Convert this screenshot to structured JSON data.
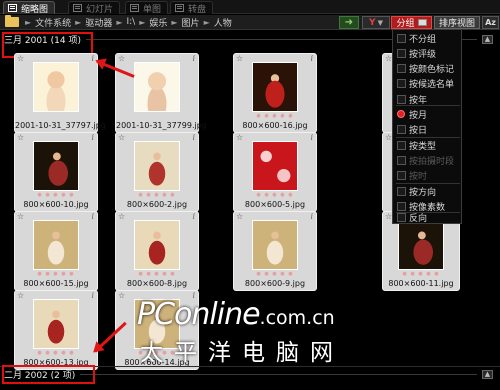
{
  "tabs": [
    {
      "label": "缩略图",
      "active": true
    },
    {
      "label": "幻灯片",
      "active": false
    },
    {
      "label": "单图",
      "active": false
    },
    {
      "label": "转盘",
      "active": false
    }
  ],
  "breadcrumbs": [
    "文件系统",
    "驱动器",
    "I:\\",
    "娱乐",
    "图片",
    "人物"
  ],
  "breadcrumb_separator": "►",
  "toolbar": {
    "filter_label": "Y",
    "group_label": "分组",
    "sort_label": "排序视图",
    "az_label": "Az"
  },
  "groups": [
    {
      "label": "三月 2001 (14 项)",
      "toggle": "▲"
    },
    {
      "label": "二月 2002 (2 项)",
      "toggle": "▲"
    }
  ],
  "thumbnails": [
    {
      "name": "2001-10-31_37797.jpg",
      "style": "baby1",
      "dots": ""
    },
    {
      "name": "2001-10-31_37799.jpg",
      "style": "baby2",
      "dots": ""
    },
    {
      "name": "800×600-16.jpg",
      "style": "red",
      "dots": "● ● ● ● ●"
    },
    {
      "name": "",
      "style": "",
      "dots": ""
    },
    {
      "name": "800×600-10.jpg",
      "style": "dark",
      "dots": "● ● ● ● ●"
    },
    {
      "name": "800×600-2.jpg",
      "style": "cream",
      "dots": "● ● ● ● ●"
    },
    {
      "name": "800×600-5.jpg",
      "style": "flowers",
      "dots": "● ● ● ● ●"
    },
    {
      "name": "",
      "style": "",
      "dots": ""
    },
    {
      "name": "800×600-15.jpg",
      "style": "gold",
      "dots": "● ● ● ● ●"
    },
    {
      "name": "800×600-8.jpg",
      "style": "pale",
      "dots": "● ● ● ● ●"
    },
    {
      "name": "800×600-9.jpg",
      "style": "gold",
      "dots": "● ● ● ● ●"
    },
    {
      "name": "800×600-11.jpg",
      "style": "dark",
      "dots": "● ● ● ● ●"
    },
    {
      "name": "800×600-13.jpg",
      "style": "pale",
      "dots": "● ● ● ● ●"
    },
    {
      "name": "800×600-14.jpg",
      "style": "gold",
      "dots": "● ● ● ● ●"
    }
  ],
  "group_menu": [
    {
      "label": "不分组",
      "kind": "check",
      "state": "normal"
    },
    {
      "label": "按评级",
      "kind": "check",
      "state": "normal"
    },
    {
      "label": "按颜色标记",
      "kind": "check",
      "state": "normal"
    },
    {
      "label": "按候选名单",
      "kind": "check",
      "state": "normal"
    },
    {
      "label": "按年",
      "kind": "check",
      "state": "normal"
    },
    {
      "label": "按月",
      "kind": "radio",
      "state": "active"
    },
    {
      "label": "按日",
      "kind": "check",
      "state": "normal"
    },
    {
      "label": "按类型",
      "kind": "check",
      "state": "normal"
    },
    {
      "label": "按拍摄时段",
      "kind": "check",
      "state": "disabled"
    },
    {
      "label": "按时",
      "kind": "check",
      "state": "disabled"
    },
    {
      "label": "按方向",
      "kind": "check",
      "state": "normal"
    },
    {
      "label": "按像素数",
      "kind": "check",
      "state": "normal"
    },
    {
      "label": "反向",
      "kind": "check",
      "state": "normal"
    }
  ],
  "watermark": {
    "line1_brand": "PConline",
    "line1_tld": ".com.cn",
    "line2": "太平洋电脑网"
  },
  "icons": {
    "folder": "folder-icon",
    "star": "star-icon",
    "info": "info-icon"
  },
  "colors": {
    "accent_red": "#e01010",
    "group_button": "#b01c1c",
    "background": "#000000"
  }
}
